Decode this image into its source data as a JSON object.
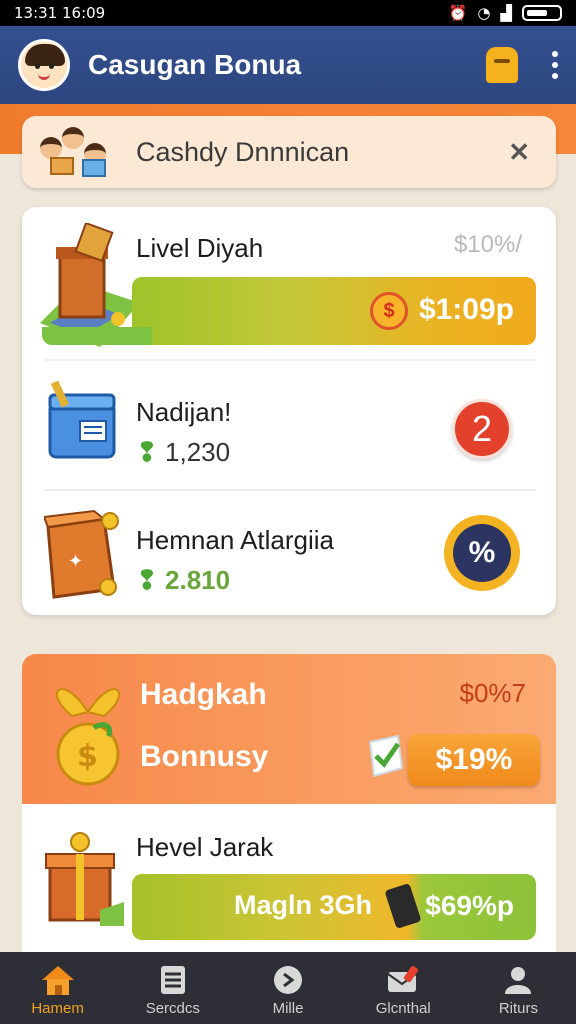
{
  "status_bar": {
    "time": "13:31 16:09"
  },
  "app_bar": {
    "title": "Casugan Bonua"
  },
  "notice": {
    "text": "Cashdy Dnnnican"
  },
  "card_rows": [
    {
      "title": "Livel Diyah",
      "amount": "$10%/",
      "bar_value": "$1:09p"
    },
    {
      "title": "Nadijan!",
      "value": "1,230",
      "badge": "2"
    },
    {
      "title": "Hemnan Atlargiia",
      "value": "2.810",
      "badge": "%"
    }
  ],
  "bonus": {
    "title": "Hadgkah",
    "subtitle": "Bonnusy",
    "amount": "$0%7",
    "pill": "$19%"
  },
  "lower_row": {
    "title": "Hevel Jarak",
    "bar_label": "Magln 3Gh",
    "bar_value": "$69%p"
  },
  "nav": [
    {
      "label": "Hamem",
      "icon": "home-icon",
      "active": true
    },
    {
      "label": "Sercdcs",
      "icon": "list-icon"
    },
    {
      "label": "Mille",
      "icon": "tag-icon"
    },
    {
      "label": "Glcnthal",
      "icon": "mail-icon"
    },
    {
      "label": "Riturs",
      "icon": "person-icon"
    }
  ]
}
